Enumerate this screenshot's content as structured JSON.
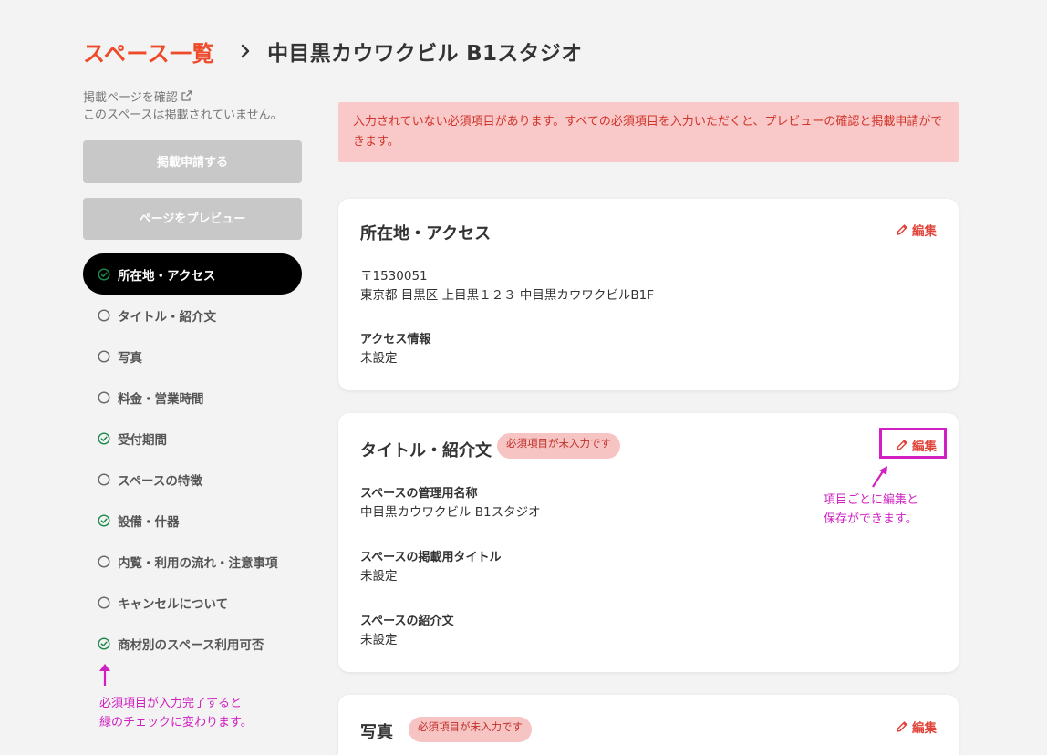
{
  "breadcrumb": {
    "root": "スペース一覧",
    "current": "中目黒カウワクビル B1スタジオ"
  },
  "sidebar": {
    "confirm_link": "掲載ページを確認",
    "not_published": "このスペースは掲載されていません。",
    "apply_button": "掲載申請する",
    "preview_button": "ページをプレビュー",
    "nav": [
      {
        "label": "所在地・アクセス",
        "status": "complete",
        "active": true
      },
      {
        "label": "タイトル・紹介文",
        "status": "incomplete",
        "active": false
      },
      {
        "label": "写真",
        "status": "incomplete",
        "active": false
      },
      {
        "label": "料金・営業時間",
        "status": "incomplete",
        "active": false
      },
      {
        "label": "受付期間",
        "status": "complete",
        "active": false
      },
      {
        "label": "スペースの特徴",
        "status": "incomplete",
        "active": false
      },
      {
        "label": "設備・什器",
        "status": "complete",
        "active": false
      },
      {
        "label": "内覧・利用の流れ・注意事項",
        "status": "incomplete",
        "active": false
      },
      {
        "label": "キャンセルについて",
        "status": "incomplete",
        "active": false
      },
      {
        "label": "商材別のスペース利用可否",
        "status": "complete",
        "active": false
      }
    ]
  },
  "alert": {
    "message": "入力されていない必須項目があります。すべての必須項目を入力いただくと、プレビューの確認と掲載申請ができます。"
  },
  "cards": {
    "access": {
      "title": "所在地・アクセス",
      "edit": "編集",
      "postal": "〒1530051",
      "address": "東京都 目黒区 上目黒１２３ 中目黒カウワクビルB1F",
      "access_label": "アクセス情報",
      "access_value": "未設定"
    },
    "title": {
      "title": "タイトル・紹介文",
      "badge": "必須項目が未入力です",
      "edit": "編集",
      "admin_name_label": "スペースの管理用名称",
      "admin_name_value": "中目黒カウワクビル B1スタジオ",
      "listing_title_label": "スペースの掲載用タイトル",
      "listing_title_value": "未設定",
      "intro_label": "スペースの紹介文",
      "intro_value": "未設定"
    },
    "photos": {
      "title": "写真",
      "badge": "必須項目が未入力です",
      "edit": "編集"
    }
  },
  "annotations": {
    "right_line1": "項目ごとに編集と",
    "right_line2": "保存ができます。",
    "left_line1": "必須項目が入力完了すると",
    "left_line2": "緑のチェックに変わります。"
  },
  "colors": {
    "accent": "#ee4a2a",
    "alert_bg": "#f9c8c8",
    "check_green": "#1e8a4c",
    "annotation": "#d11fc2"
  }
}
